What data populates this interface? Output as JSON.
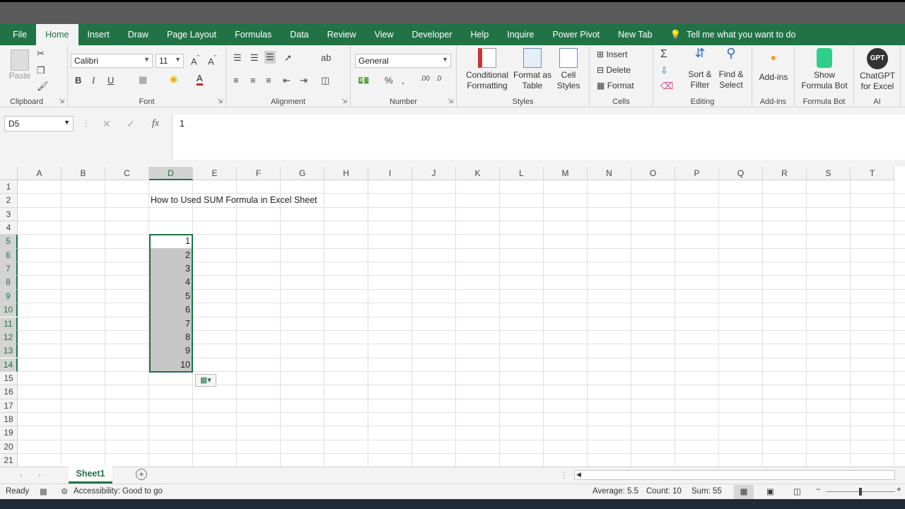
{
  "ribbon_tabs": [
    "File",
    "Home",
    "Insert",
    "Draw",
    "Page Layout",
    "Formulas",
    "Data",
    "Review",
    "View",
    "Developer",
    "Help",
    "Inquire",
    "Power Pivot",
    "New Tab"
  ],
  "tell_me": "Tell me what you want to do",
  "clipboard": {
    "paste": "Paste",
    "label": "Clipboard"
  },
  "font": {
    "name": "Calibri",
    "size": "11",
    "label": "Font",
    "bold": "B",
    "italic": "I",
    "underline": "U"
  },
  "alignment": {
    "label": "Alignment"
  },
  "number": {
    "format": "General",
    "label": "Number",
    "percent": "%"
  },
  "styles": {
    "conditional_1": "Conditional",
    "conditional_2": "Formatting",
    "format_as_1": "Format as",
    "format_as_2": "Table",
    "cell_styles_1": "Cell",
    "cell_styles_2": "Styles",
    "label": "Styles"
  },
  "cells": {
    "insert": "Insert",
    "delete": "Delete",
    "format": "Format",
    "label": "Cells"
  },
  "editing": {
    "sort_1": "Sort &",
    "sort_2": "Filter",
    "find_1": "Find &",
    "find_2": "Select",
    "label": "Editing"
  },
  "addins": {
    "button": "Add-ins",
    "label": "Add-ins"
  },
  "formulabot": {
    "btn_1": "Show",
    "btn_2": "Formula Bot",
    "label": "Formula Bot"
  },
  "ai": {
    "btn_1": "ChatGPT",
    "btn_2": "for Excel",
    "label": "AI",
    "badge": "GPT"
  },
  "formula_bar": {
    "name_box": "D5",
    "fx": "fx",
    "content": "1"
  },
  "columns": [
    "A",
    "B",
    "C",
    "D",
    "E",
    "F",
    "G",
    "H",
    "I",
    "J",
    "K",
    "L",
    "M",
    "N",
    "O",
    "P",
    "Q",
    "R",
    "S",
    "T"
  ],
  "rows": [
    "1",
    "2",
    "3",
    "4",
    "5",
    "6",
    "7",
    "8",
    "9",
    "10",
    "11",
    "12",
    "13",
    "14",
    "15",
    "16",
    "17",
    "18",
    "19",
    "20",
    "21"
  ],
  "cells_content": {
    "d2": "How to Used SUM Formula in Excel Sheet",
    "values": [
      "1",
      "2",
      "3",
      "4",
      "5",
      "6",
      "7",
      "8",
      "9",
      "10"
    ]
  },
  "sheet": {
    "tab": "Sheet1",
    "add": "+"
  },
  "status": {
    "ready": "Ready",
    "accessibility": "Accessibility: Good to go",
    "average": "Average: 5.5",
    "count": "Count: 10",
    "sum": "Sum: 55"
  },
  "colors": {
    "excel_green": "#217346",
    "selection_fill": "#c6c6c6"
  }
}
